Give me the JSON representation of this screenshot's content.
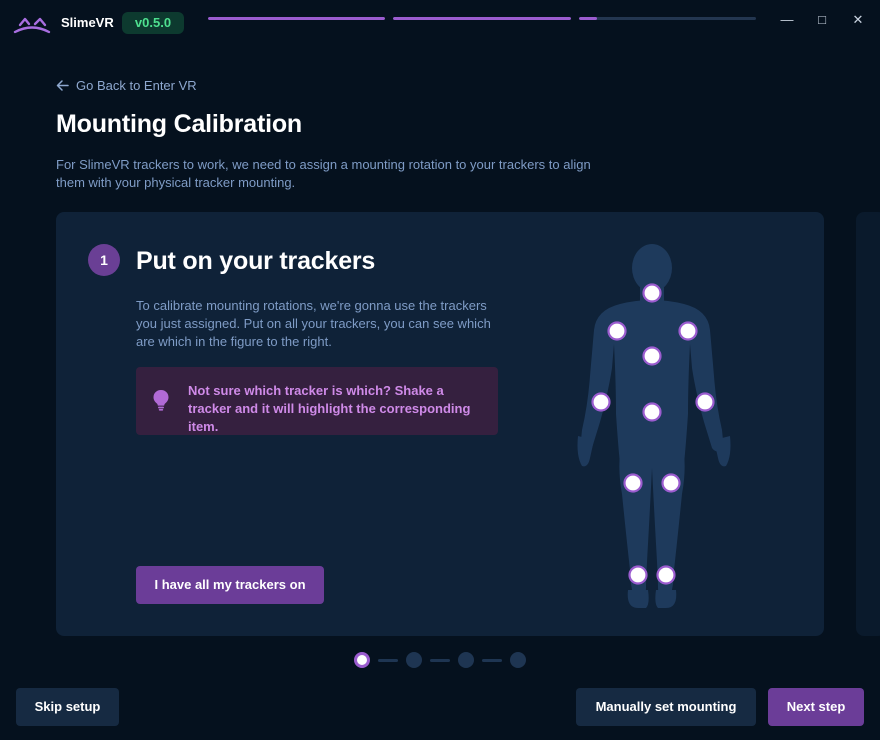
{
  "app": {
    "name": "SlimeVR",
    "version": "v0.5.0",
    "wizard_progress": [
      1,
      1,
      0.1
    ]
  },
  "window_controls": {
    "minimize": "—",
    "maximize": "□",
    "close": "✕"
  },
  "header": {
    "back_link": "Go Back to Enter VR",
    "title": "Mounting Calibration",
    "description": "For SlimeVR trackers to work, we need to assign a mounting rotation to your trackers to align them with your physical tracker mounting."
  },
  "step": {
    "number": "1",
    "title": "Put on your trackers",
    "description": "To calibrate mounting rotations, we're gonna use the trackers you just assigned. Put on all your trackers, you can see which are which in the figure to the right.",
    "tip": "Not sure which tracker is which? Shake a tracker and it will highlight the corresponding item.",
    "confirm_button": "I have all my trackers on"
  },
  "pagination": {
    "total": 4,
    "current": 1
  },
  "footer": {
    "skip_button": "Skip setup",
    "manual_button": "Manually set mounting",
    "next_button": "Next step"
  },
  "colors": {
    "accent": "#9b5ccf",
    "version_text": "#4ee08f",
    "tip_text": "#cf8ae8",
    "body_silhouette": "#1e3a5c"
  }
}
